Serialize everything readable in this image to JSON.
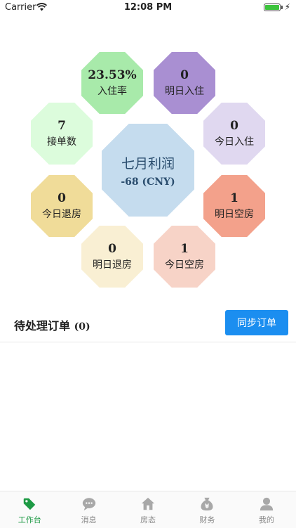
{
  "status_bar": {
    "carrier": "Carrier",
    "time": "12:08 PM"
  },
  "dashboard": {
    "center": {
      "label": "七月利润",
      "value": "-68 (CNY)",
      "color": "#c5dcee"
    },
    "stats": [
      {
        "id": "occupancy-rate",
        "value": "23.53%",
        "label": "入住率",
        "color": "#a8eaaa"
      },
      {
        "id": "tomorrow-checkin",
        "value": "0",
        "label": "明日入住",
        "color": "#a98fd2"
      },
      {
        "id": "today-checkin",
        "value": "0",
        "label": "今日入住",
        "color": "#e0d8f0"
      },
      {
        "id": "tomorrow-vacant",
        "value": "1",
        "label": "明日空房",
        "color": "#f3a18b"
      },
      {
        "id": "today-vacant",
        "value": "1",
        "label": "今日空房",
        "color": "#f7d3c7"
      },
      {
        "id": "tomorrow-checkout",
        "value": "0",
        "label": "明日退房",
        "color": "#f9efd3"
      },
      {
        "id": "today-checkout",
        "value": "0",
        "label": "今日退房",
        "color": "#f0dc99"
      },
      {
        "id": "orders-accepted",
        "value": "7",
        "label": "接单数",
        "color": "#dcfcdc"
      }
    ]
  },
  "pending": {
    "title": "待处理订单",
    "count": "(0)",
    "sync_label": "同步订单",
    "sync_color": "#1b8ef0"
  },
  "tabs": [
    {
      "id": "workbench",
      "label": "工作台",
      "icon": "tag-icon",
      "active": true
    },
    {
      "id": "messages",
      "label": "消息",
      "icon": "chat-icon",
      "active": false
    },
    {
      "id": "room-status",
      "label": "房态",
      "icon": "house-icon",
      "active": false
    },
    {
      "id": "finance",
      "label": "财务",
      "icon": "money-bag-icon",
      "active": false
    },
    {
      "id": "mine",
      "label": "我的",
      "icon": "user-icon",
      "active": false
    }
  ],
  "colors": {
    "active_tab": "#1e9a45",
    "inactive_tab": "#a8a8a8"
  }
}
